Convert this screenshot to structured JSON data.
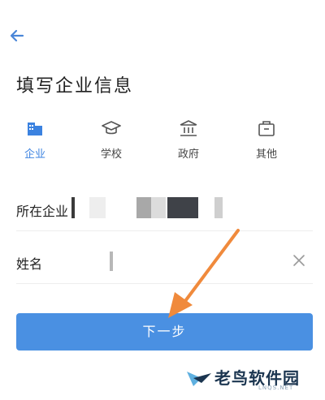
{
  "header": {
    "title": "填写企业信息"
  },
  "org_types": [
    {
      "label": "企业",
      "icon": "building-icon",
      "active": true
    },
    {
      "label": "学校",
      "icon": "graduation-cap-icon",
      "active": false
    },
    {
      "label": "政府",
      "icon": "government-icon",
      "active": false
    },
    {
      "label": "其他",
      "icon": "briefcase-icon",
      "active": false
    }
  ],
  "form": {
    "company_label": "所在企业",
    "name_label": "姓名"
  },
  "actions": {
    "next_label": "下一步"
  },
  "watermark": {
    "brand": "老鸟软件园",
    "domain": "LNQS.NET"
  },
  "colors": {
    "accent": "#4a90e2",
    "active_tab": "#3b82e0",
    "arrow": "#f08a3c"
  }
}
